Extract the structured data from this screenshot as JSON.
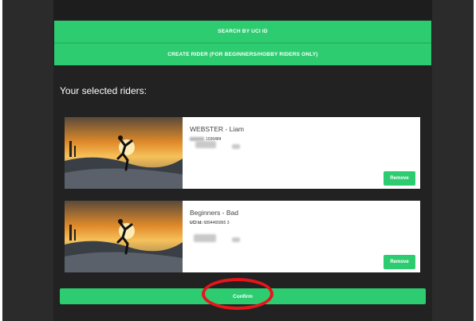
{
  "actions": {
    "search_label": "SEARCH BY UCI ID",
    "create_label": "CREATE RIDER (FOR BEGINNERS/HOBBY RIDERS ONLY)"
  },
  "selected": {
    "heading": "Your selected riders:",
    "riders": [
      {
        "name": "WEBSTER - Liam",
        "uci_prefix": "",
        "uci_id": "1036484",
        "remove_label": "Remove"
      },
      {
        "name": "Beginners - Bad",
        "uci_prefix": "UCI Id:",
        "uci_id": "6894465865 3",
        "remove_label": "Remove"
      }
    ]
  },
  "confirm_label": "Confirm",
  "colors": {
    "accent": "#2ecc71",
    "annotation": "#e8141b",
    "background": "#2b2b2b"
  }
}
